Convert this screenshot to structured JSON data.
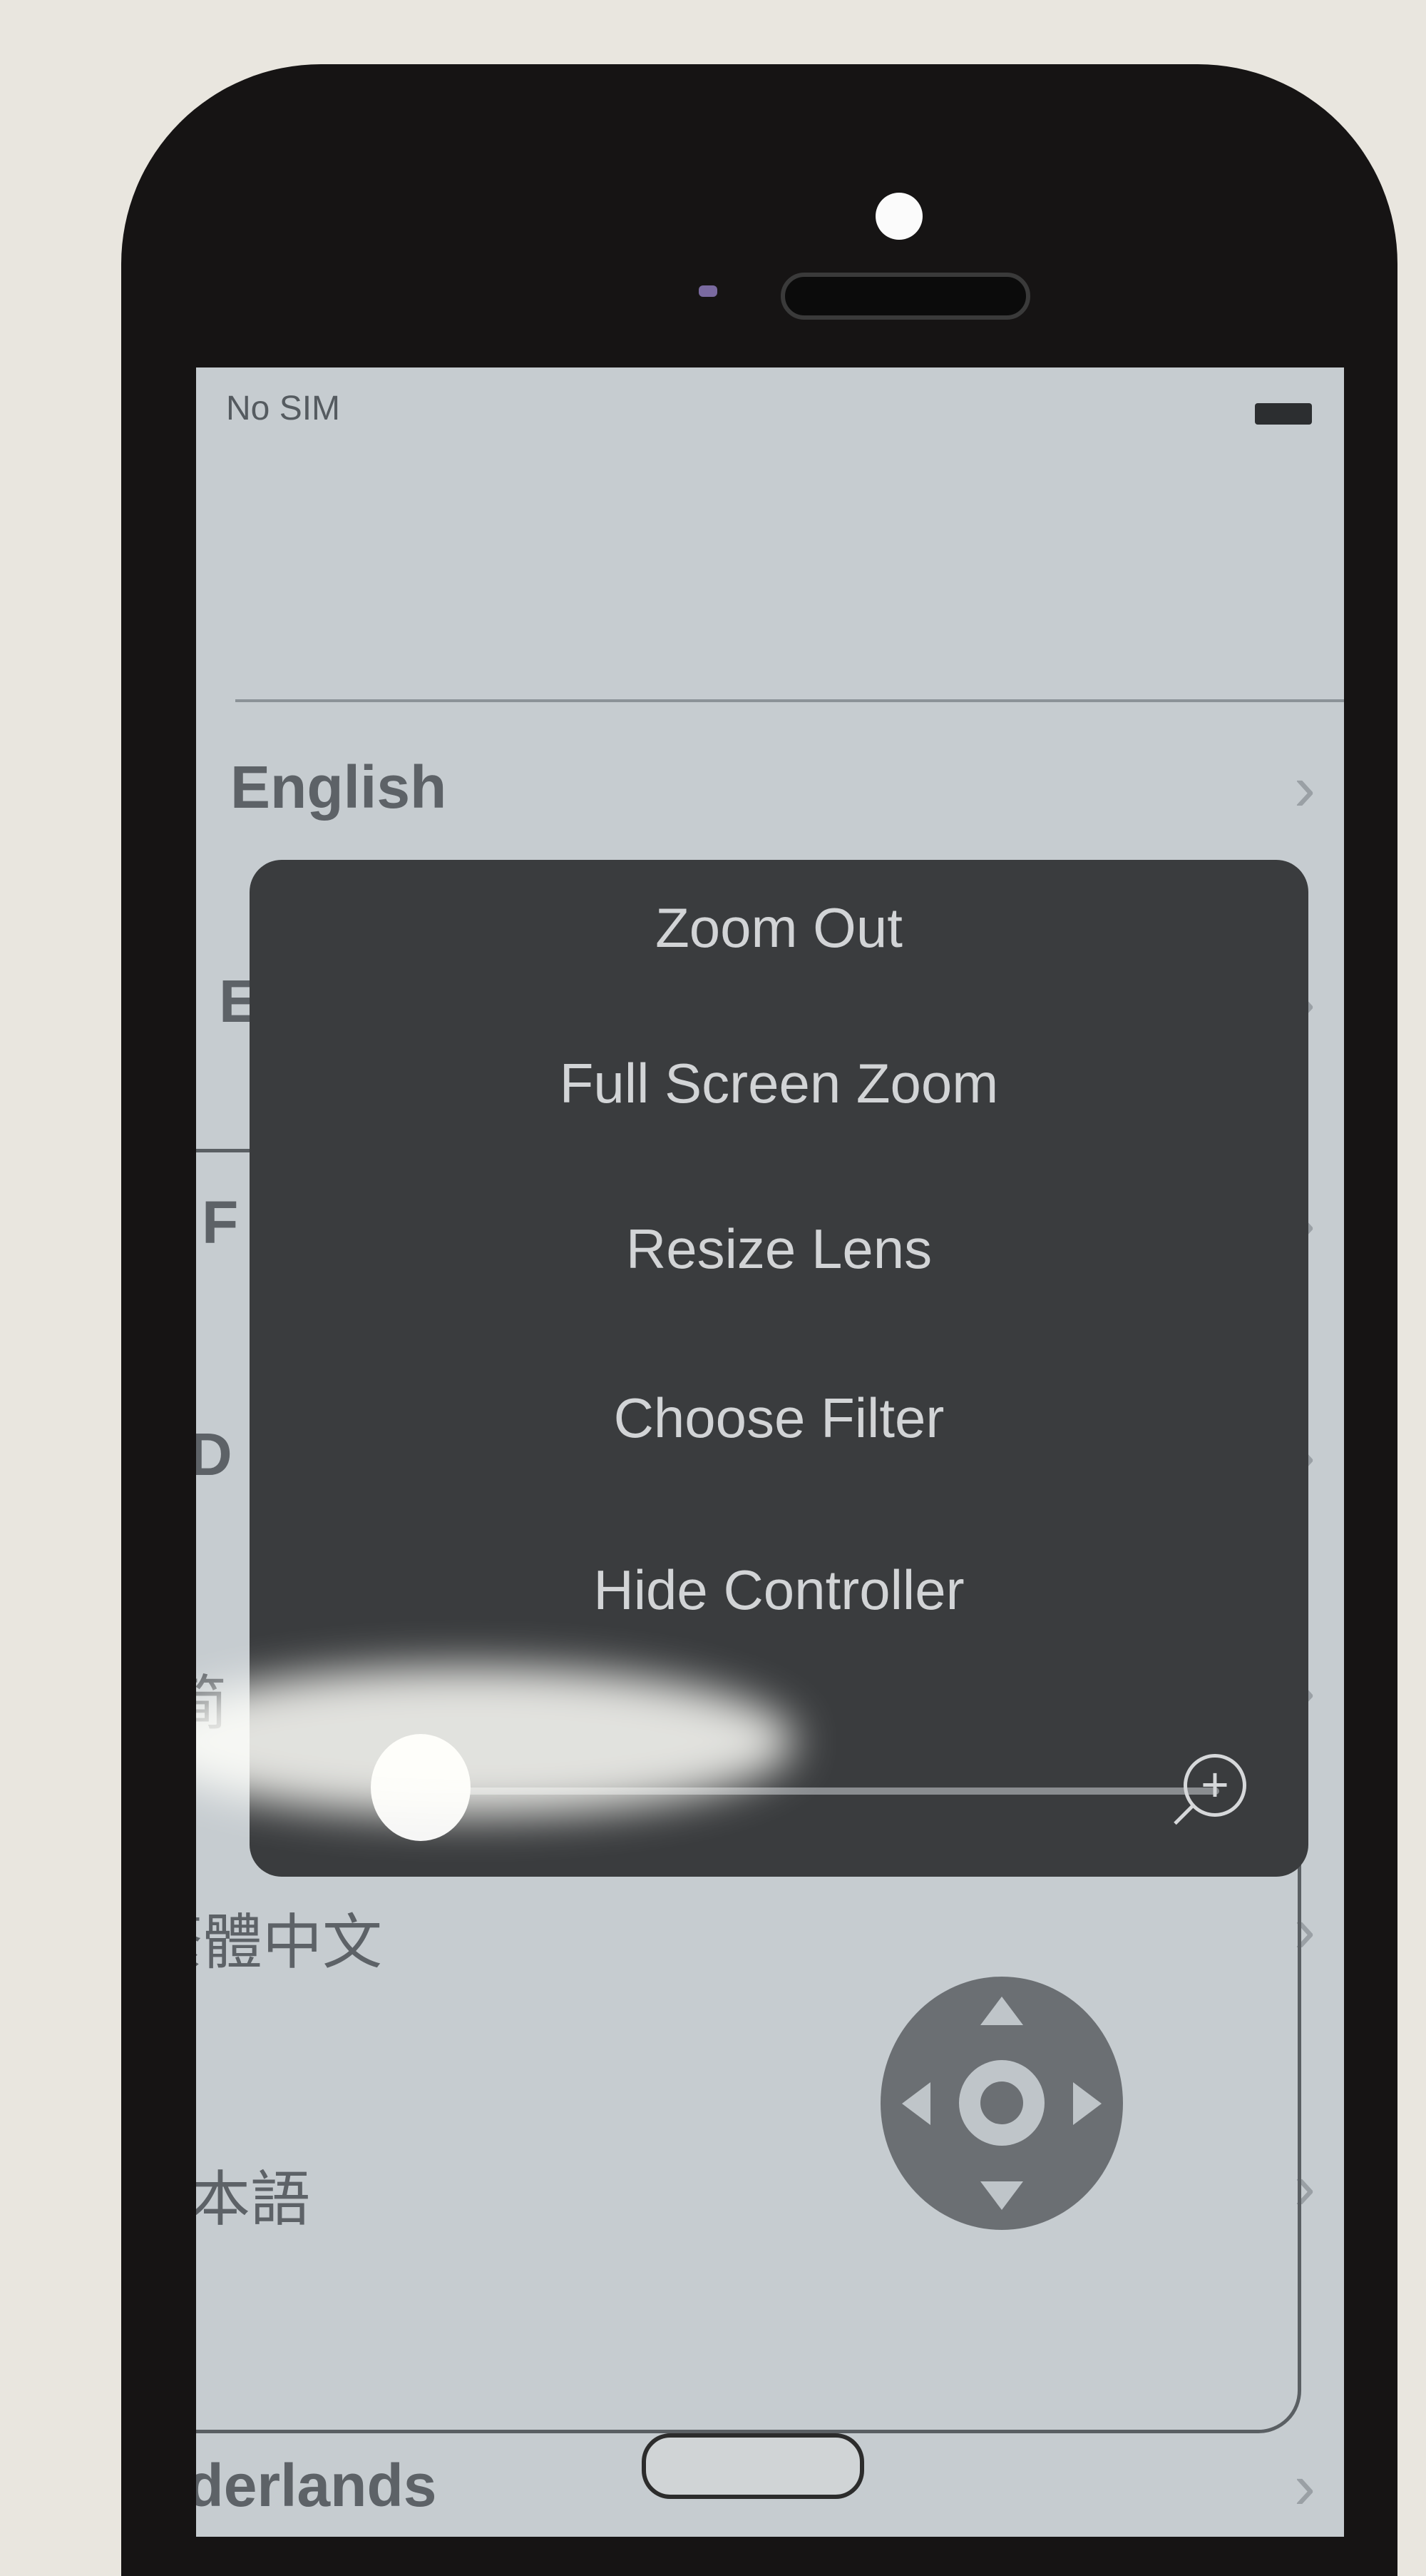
{
  "status_bar": {
    "carrier": "No SIM"
  },
  "languages": [
    {
      "label": "English"
    },
    {
      "label": "E"
    },
    {
      "label": "F"
    },
    {
      "label": "D"
    },
    {
      "label": "简"
    },
    {
      "label": "繁體中文"
    },
    {
      "label": "日本語"
    },
    {
      "label": "Nederlands"
    }
  ],
  "zoom_menu": {
    "items": [
      {
        "label": "Zoom Out"
      },
      {
        "label": "Full Screen Zoom"
      },
      {
        "label": "Resize Lens"
      },
      {
        "label": "Choose Filter"
      },
      {
        "label": "Hide Controller"
      }
    ],
    "zoom_in_icon": "plus"
  },
  "zoom_controller": {
    "icon": "dpad"
  }
}
